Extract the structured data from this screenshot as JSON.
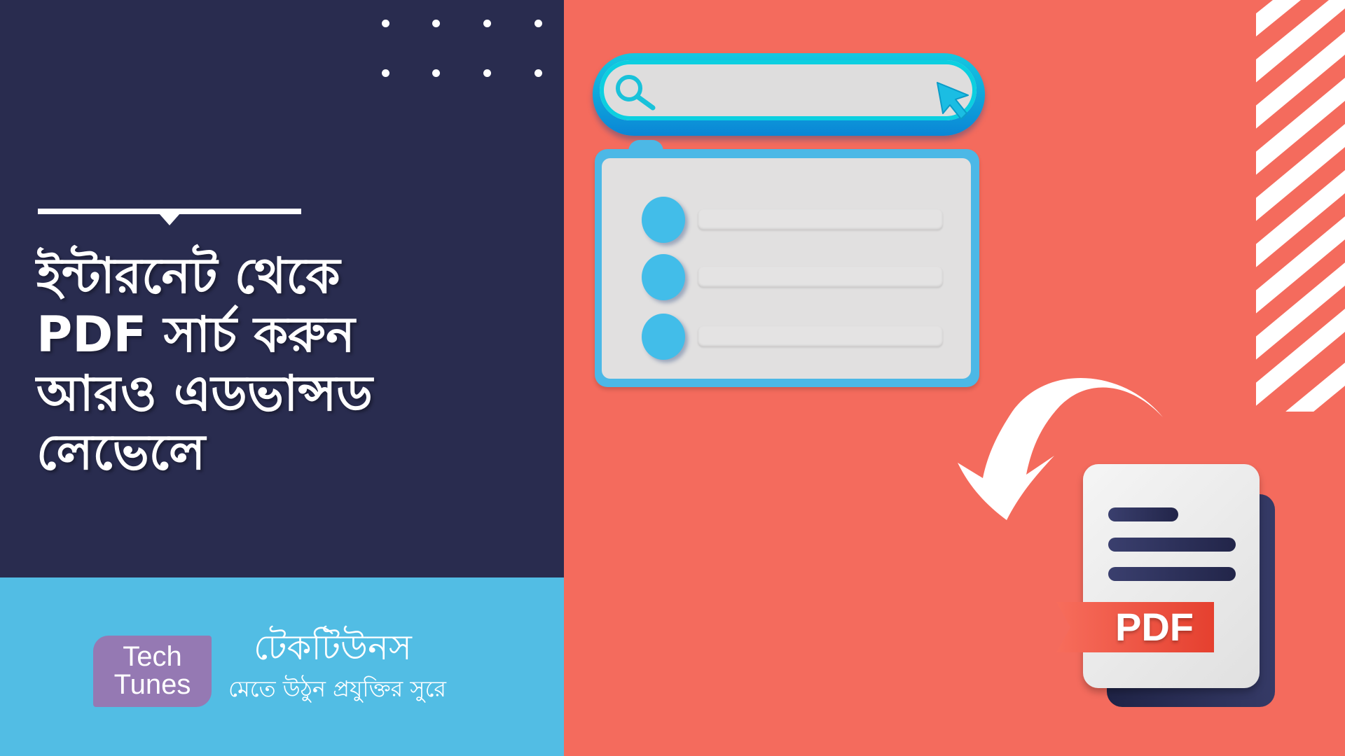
{
  "headline": {
    "lines": [
      "ইন্টারনেট থেকে",
      "PDF সার্চ করুন",
      "আরও এডভান্সড",
      "লেভেলে"
    ]
  },
  "branding": {
    "logo_line1": "Tech",
    "logo_line2": "Tunes",
    "brand_name": "টেকটিউনস",
    "tagline": "মেতে উঠুন প্রযুক্তির সুরে"
  },
  "illustration": {
    "search_icon": "search-icon",
    "cursor_icon": "cursor-arrow-icon",
    "list_items_count": 3,
    "arrow_icon": "curved-arrow-icon",
    "file_badge": "PDF"
  },
  "colors": {
    "navy": "#292c4f",
    "coral": "#f46b5d",
    "sky_blue": "#52bde4",
    "logo_purple": "#9579b3",
    "cyan_accent": "#15c8e0",
    "pdf_red": "#e8473a"
  }
}
